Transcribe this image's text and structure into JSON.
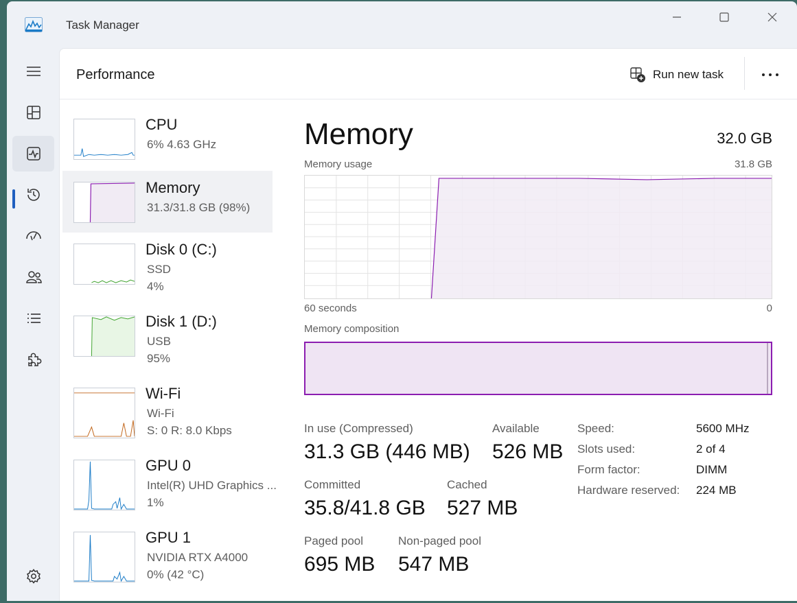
{
  "window": {
    "title": "Task Manager",
    "accent": "#1f5fbf"
  },
  "nav": {
    "items": [
      {
        "id": "hamburger",
        "icon": "hamburger-menu-icon"
      },
      {
        "id": "processes",
        "icon": "processes-icon"
      },
      {
        "id": "performance",
        "icon": "performance-icon",
        "active": true
      },
      {
        "id": "app-history",
        "icon": "history-icon"
      },
      {
        "id": "startup",
        "icon": "startup-apps-icon"
      },
      {
        "id": "users",
        "icon": "users-icon"
      },
      {
        "id": "details",
        "icon": "details-list-icon"
      },
      {
        "id": "services",
        "icon": "services-puzzle-icon"
      },
      {
        "id": "settings",
        "icon": "settings-gear-icon"
      }
    ]
  },
  "header": {
    "title": "Performance",
    "run_task_label": "Run new task"
  },
  "sidebar": {
    "items": [
      {
        "name": "CPU",
        "line1": "6%  4.63 GHz",
        "line2": "",
        "color": "#1a7bc7"
      },
      {
        "name": "Memory",
        "line1": "31.3/31.8 GB (98%)",
        "line2": "",
        "color": "#8b1db0",
        "selected": true
      },
      {
        "name": "Disk 0 (C:)",
        "line1": "SSD",
        "line2": "4%",
        "color": "#3fa32e"
      },
      {
        "name": "Disk 1 (D:)",
        "line1": "USB",
        "line2": "95%",
        "color": "#3fa32e"
      },
      {
        "name": "Wi-Fi",
        "line1": "Wi-Fi",
        "line2": "S: 0  R: 8.0 Kbps",
        "color": "#c0651a"
      },
      {
        "name": "GPU 0",
        "line1": "Intel(R) UHD Graphics ...",
        "line2": "1%",
        "color": "#1a7bc7"
      },
      {
        "name": "GPU 1",
        "line1": "NVIDIA RTX A4000",
        "line2": "0%  (42 °C)",
        "color": "#1a7bc7"
      }
    ]
  },
  "memory": {
    "title": "Memory",
    "total": "32.0 GB",
    "usage_label": "Memory usage",
    "usage_max": "31.8 GB",
    "axis_left": "60 seconds",
    "axis_right": "0",
    "composition_label": "Memory composition",
    "stats": {
      "in_use_label": "In use (Compressed)",
      "in_use_value": "31.3 GB (446 MB)",
      "available_label": "Available",
      "available_value": "526 MB",
      "committed_label": "Committed",
      "committed_value": "35.8/41.8 GB",
      "cached_label": "Cached",
      "cached_value": "527 MB",
      "paged_label": "Paged pool",
      "paged_value": "695 MB",
      "nonpaged_label": "Non-paged pool",
      "nonpaged_value": "547 MB"
    },
    "specs": [
      {
        "label": "Speed:",
        "value": "5600 MHz"
      },
      {
        "label": "Slots used:",
        "value": "2 of 4"
      },
      {
        "label": "Form factor:",
        "value": "DIMM"
      },
      {
        "label": "Hardware reserved:",
        "value": "224 MB"
      }
    ]
  }
}
